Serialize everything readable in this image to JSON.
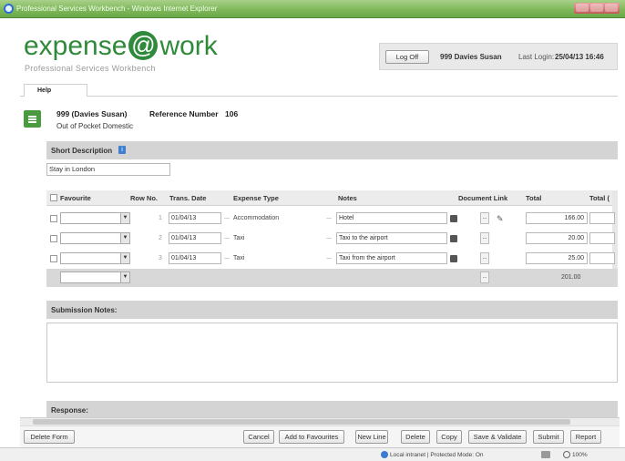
{
  "window": {
    "title": "Professional Services Workbench - Windows Internet Explorer"
  },
  "brand": {
    "logo_pre": "expense",
    "logo_at": "@",
    "logo_post": "work",
    "tagline": "Professional Services Workbench"
  },
  "user": {
    "logoff_label": "Log Off",
    "name": "999 Davies Susan",
    "last_login_label": "Last Login:",
    "last_login_value": "25/04/13 16:46"
  },
  "tabs": [
    {
      "label": "Help"
    }
  ],
  "header": {
    "employee": "999 (Davies Susan)",
    "reference_label": "Reference Number",
    "reference_value": "106",
    "claim_type": "Out of Pocket Domestic"
  },
  "short_description": {
    "label": "Short Description",
    "info_icon": "info-icon",
    "value": "Stay in London"
  },
  "table": {
    "headers": {
      "favourite": "Favourite",
      "row_no": "Row No.",
      "trans_date": "Trans. Date",
      "expense_type": "Expense Type",
      "notes": "Notes",
      "document_link": "Document Link",
      "total": "Total",
      "total_extra": "Total ("
    },
    "rows": [
      {
        "row_no": "1",
        "date": "01/04/13",
        "expense_type": "Accommodation",
        "notes": "Hotel",
        "total": "166.00",
        "has_attachment": true
      },
      {
        "row_no": "2",
        "date": "01/04/13",
        "expense_type": "Taxi",
        "notes": "Taxi to the airport",
        "total": "20.00",
        "has_attachment": false
      },
      {
        "row_no": "3",
        "date": "01/04/13",
        "expense_type": "Taxi",
        "notes": "Taxi from the airport",
        "total": "25.00",
        "has_attachment": false
      }
    ],
    "ellipsis": "...",
    "grand_total": "201.00"
  },
  "submission_notes": {
    "label": "Submission Notes:"
  },
  "response": {
    "label": "Response:"
  },
  "footer": {
    "delete_form": "Delete Form",
    "cancel": "Cancel",
    "add_to_favourites": "Add to Favourites",
    "new_line": "New Line",
    "delete": "Delete",
    "copy": "Copy",
    "save_validate": "Save & Validate",
    "submit": "Submit",
    "report": "Report"
  },
  "statusbar": {
    "zone": "Local intranet | Protected Mode: On",
    "zoom": "100%"
  },
  "colors": {
    "brand_green": "#2f8a3b",
    "section_grey": "#d4d4d4",
    "titlebar_green": "#7fb85a"
  }
}
